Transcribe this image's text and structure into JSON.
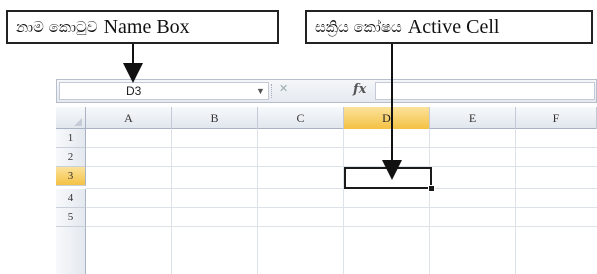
{
  "callouts": {
    "name_box": {
      "sinhala": "නාම කොටුව",
      "english": "Name Box"
    },
    "active_cell": {
      "sinhala": "සක්‍රිය කෝෂය",
      "english": "Active Cell"
    }
  },
  "formula_bar": {
    "name_box_value": "D3",
    "fx_label": "fx"
  },
  "columns": [
    "A",
    "B",
    "C",
    "D",
    "E",
    "F"
  ],
  "rows": [
    "1",
    "2",
    "3",
    "4",
    "5"
  ],
  "active_cell": {
    "column": "D",
    "row": "3"
  },
  "colors": {
    "active_header": "#f4c244",
    "grid_line": "#dde2e9"
  }
}
